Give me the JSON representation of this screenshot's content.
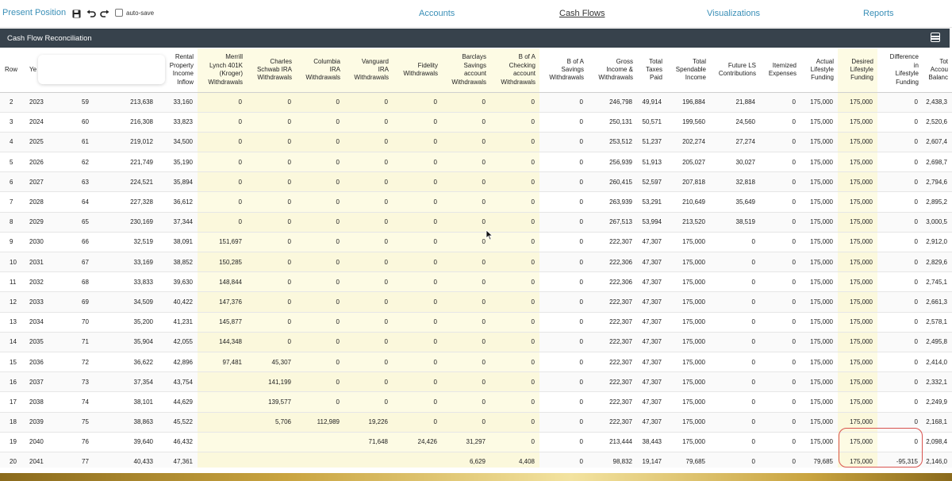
{
  "topbar": {
    "present_position": "Present Position",
    "autosave_label": "auto-save",
    "nav": [
      "Accounts",
      "Cash Flows",
      "Visualizations",
      "Reports"
    ]
  },
  "panel": {
    "title": "Cash Flow Reconciliation"
  },
  "table": {
    "headers": [
      [
        "Row"
      ],
      [
        "Ye"
      ],
      [
        ""
      ],
      [
        ""
      ],
      [
        "Rental",
        "Property",
        "Income",
        "Inflow"
      ],
      [
        "Merrill",
        "Lynch 401K",
        "(Kroger)",
        "Withdrawals"
      ],
      [
        "Charles",
        "Schwab IRA",
        "Withdrawals"
      ],
      [
        "Columbia",
        "IRA",
        "Withdrawals"
      ],
      [
        "Vanguard",
        "IRA",
        "Withdrawals"
      ],
      [
        "Fidelity",
        "Withdrawals"
      ],
      [
        "Barclays",
        "Savings",
        "account",
        "Withdrawals"
      ],
      [
        "B of A",
        "Checking",
        "account",
        "Withdrawals"
      ],
      [
        "B of A",
        "Savings",
        "Withdrawals"
      ],
      [
        "Gross",
        "Income &",
        "Withdrawals"
      ],
      [
        "Total",
        "Taxes",
        "Paid"
      ],
      [
        "Total",
        "Spendable",
        "Income"
      ],
      [
        "Future LS",
        "Contributions"
      ],
      [
        "Itemized",
        "Expenses"
      ],
      [
        "Actual",
        "Lifestyle",
        "Funding"
      ],
      [
        "Desired",
        "Lifestyle",
        "Funding"
      ],
      [
        "Difference",
        "in",
        "Lifestyle",
        "Funding"
      ],
      [
        "Tot",
        "Accou",
        "Balanc"
      ]
    ],
    "rows": [
      [
        "2",
        "2023",
        "59",
        "213,638",
        "33,160",
        "0",
        "0",
        "0",
        "0",
        "0",
        "0",
        "0",
        "0",
        "246,798",
        "49,914",
        "196,884",
        "21,884",
        "0",
        "175,000",
        "175,000",
        "0",
        "2,438,3"
      ],
      [
        "3",
        "2024",
        "60",
        "216,308",
        "33,823",
        "0",
        "0",
        "0",
        "0",
        "0",
        "0",
        "0",
        "0",
        "250,131",
        "50,571",
        "199,560",
        "24,560",
        "0",
        "175,000",
        "175,000",
        "0",
        "2,520,6"
      ],
      [
        "4",
        "2025",
        "61",
        "219,012",
        "34,500",
        "0",
        "0",
        "0",
        "0",
        "0",
        "0",
        "0",
        "0",
        "253,512",
        "51,237",
        "202,274",
        "27,274",
        "0",
        "175,000",
        "175,000",
        "0",
        "2,607,4"
      ],
      [
        "5",
        "2026",
        "62",
        "221,749",
        "35,190",
        "0",
        "0",
        "0",
        "0",
        "0",
        "0",
        "0",
        "0",
        "256,939",
        "51,913",
        "205,027",
        "30,027",
        "0",
        "175,000",
        "175,000",
        "0",
        "2,698,7"
      ],
      [
        "6",
        "2027",
        "63",
        "224,521",
        "35,894",
        "0",
        "0",
        "0",
        "0",
        "0",
        "0",
        "0",
        "0",
        "260,415",
        "52,597",
        "207,818",
        "32,818",
        "0",
        "175,000",
        "175,000",
        "0",
        "2,794,6"
      ],
      [
        "7",
        "2028",
        "64",
        "227,328",
        "36,612",
        "0",
        "0",
        "0",
        "0",
        "0",
        "0",
        "0",
        "0",
        "263,939",
        "53,291",
        "210,649",
        "35,649",
        "0",
        "175,000",
        "175,000",
        "0",
        "2,895,2"
      ],
      [
        "8",
        "2029",
        "65",
        "230,169",
        "37,344",
        "0",
        "0",
        "0",
        "0",
        "0",
        "0",
        "0",
        "0",
        "267,513",
        "53,994",
        "213,520",
        "38,519",
        "0",
        "175,000",
        "175,000",
        "0",
        "3,000,5"
      ],
      [
        "9",
        "2030",
        "66",
        "32,519",
        "38,091",
        "151,697",
        "0",
        "0",
        "0",
        "0",
        "0",
        "0",
        "0",
        "222,307",
        "47,307",
        "175,000",
        "0",
        "0",
        "175,000",
        "175,000",
        "0",
        "2,912,0"
      ],
      [
        "10",
        "2031",
        "67",
        "33,169",
        "38,852",
        "150,285",
        "0",
        "0",
        "0",
        "0",
        "0",
        "0",
        "0",
        "222,306",
        "47,307",
        "175,000",
        "0",
        "0",
        "175,000",
        "175,000",
        "0",
        "2,829,6"
      ],
      [
        "11",
        "2032",
        "68",
        "33,833",
        "39,630",
        "148,844",
        "0",
        "0",
        "0",
        "0",
        "0",
        "0",
        "0",
        "222,306",
        "47,307",
        "175,000",
        "0",
        "0",
        "175,000",
        "175,000",
        "0",
        "2,745,1"
      ],
      [
        "12",
        "2033",
        "69",
        "34,509",
        "40,422",
        "147,376",
        "0",
        "0",
        "0",
        "0",
        "0",
        "0",
        "0",
        "222,307",
        "47,307",
        "175,000",
        "0",
        "0",
        "175,000",
        "175,000",
        "0",
        "2,661,3"
      ],
      [
        "13",
        "2034",
        "70",
        "35,200",
        "41,231",
        "145,877",
        "0",
        "0",
        "0",
        "0",
        "0",
        "0",
        "0",
        "222,307",
        "47,307",
        "175,000",
        "0",
        "0",
        "175,000",
        "175,000",
        "0",
        "2,578,1"
      ],
      [
        "14",
        "2035",
        "71",
        "35,904",
        "42,055",
        "144,348",
        "0",
        "0",
        "0",
        "0",
        "0",
        "0",
        "0",
        "222,307",
        "47,307",
        "175,000",
        "0",
        "0",
        "175,000",
        "175,000",
        "0",
        "2,495,8"
      ],
      [
        "15",
        "2036",
        "72",
        "36,622",
        "42,896",
        "97,481",
        "45,307",
        "0",
        "0",
        "0",
        "0",
        "0",
        "0",
        "222,307",
        "47,307",
        "175,000",
        "0",
        "0",
        "175,000",
        "175,000",
        "0",
        "2,414,0"
      ],
      [
        "16",
        "2037",
        "73",
        "37,354",
        "43,754",
        "",
        "141,199",
        "0",
        "0",
        "0",
        "0",
        "0",
        "0",
        "222,307",
        "47,307",
        "175,000",
        "0",
        "0",
        "175,000",
        "175,000",
        "0",
        "2,332,1"
      ],
      [
        "17",
        "2038",
        "74",
        "38,101",
        "44,629",
        "",
        "139,577",
        "0",
        "0",
        "0",
        "0",
        "0",
        "0",
        "222,307",
        "47,307",
        "175,000",
        "0",
        "0",
        "175,000",
        "175,000",
        "0",
        "2,249,9"
      ],
      [
        "18",
        "2039",
        "75",
        "38,863",
        "45,522",
        "",
        "5,706",
        "112,989",
        "19,226",
        "0",
        "0",
        "0",
        "0",
        "222,307",
        "47,307",
        "175,000",
        "0",
        "0",
        "175,000",
        "175,000",
        "0",
        "2,168,1"
      ],
      [
        "19",
        "2040",
        "76",
        "39,640",
        "46,432",
        "",
        "",
        "",
        "71,648",
        "24,426",
        "31,297",
        "0",
        "0",
        "213,444",
        "38,443",
        "175,000",
        "0",
        "0",
        "175,000",
        "175,000",
        "0",
        "2,098,4"
      ],
      [
        "20",
        "2041",
        "77",
        "40,433",
        "47,361",
        "",
        "",
        "",
        "",
        "",
        "6,629",
        "4,408",
        "0",
        "98,832",
        "19,147",
        "79,685",
        "0",
        "0",
        "79,685",
        "175,000",
        "-95,315",
        "2,146,0"
      ]
    ]
  }
}
